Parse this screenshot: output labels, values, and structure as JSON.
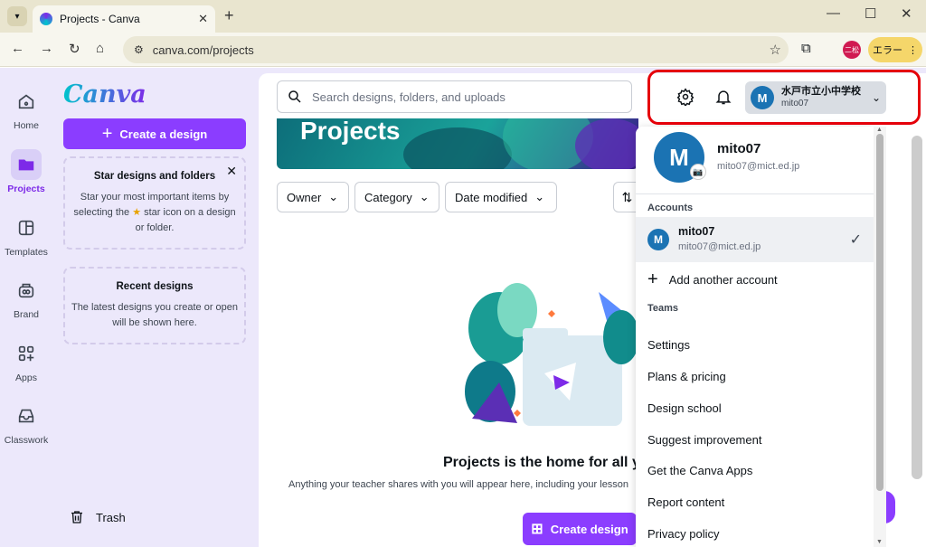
{
  "browser": {
    "tab_title": "Projects - Canva",
    "url": "canva.com/projects",
    "profile_badge": "二松",
    "error_label": "エラー"
  },
  "rail": {
    "items": [
      {
        "label": "Home",
        "icon": "home-icon"
      },
      {
        "label": "Projects",
        "icon": "folder-icon"
      },
      {
        "label": "Templates",
        "icon": "templates-icon"
      },
      {
        "label": "Brand",
        "icon": "brand-icon"
      },
      {
        "label": "Apps",
        "icon": "apps-icon"
      },
      {
        "label": "Classwork",
        "icon": "classwork-icon"
      }
    ],
    "active": "Projects"
  },
  "sidebar": {
    "logo": "Canva",
    "create_label": "Create a design",
    "star_card": {
      "title": "Star designs and folders",
      "body_before": "Star your most important items by selecting the",
      "body_after": "star icon on a design or folder."
    },
    "recent_card": {
      "title": "Recent designs",
      "body": "The latest designs you create or open will be shown here."
    },
    "trash_label": "Trash"
  },
  "header": {
    "search_placeholder": "Search designs, folders, and uploads",
    "team_name": "水戸市立小中学校",
    "username": "mito07"
  },
  "main": {
    "hero_title": "Projects",
    "filters": [
      "Owner",
      "Category",
      "Date modified"
    ],
    "empty_title": "Projects is the home for all y",
    "empty_sub": "Anything your teacher shares with you will appear here, including your lesson",
    "create_label": "Create design"
  },
  "account_menu": {
    "avatar_letter": "M",
    "name": "mito07",
    "email": "mito07@mict.ed.jp",
    "accounts_heading": "Accounts",
    "account": {
      "name": "mito07",
      "email": "mito07@mict.ed.jp"
    },
    "add_account_label": "Add another account",
    "teams_heading": "Teams",
    "items": [
      "Settings",
      "Plans & pricing",
      "Design school",
      "Suggest improvement",
      "Get the Canva Apps",
      "Report content",
      "Privacy policy"
    ]
  },
  "colors": {
    "brand_purple": "#8b3dff",
    "avatar_blue": "#1b73b3",
    "highlight_red": "#e5000a"
  }
}
